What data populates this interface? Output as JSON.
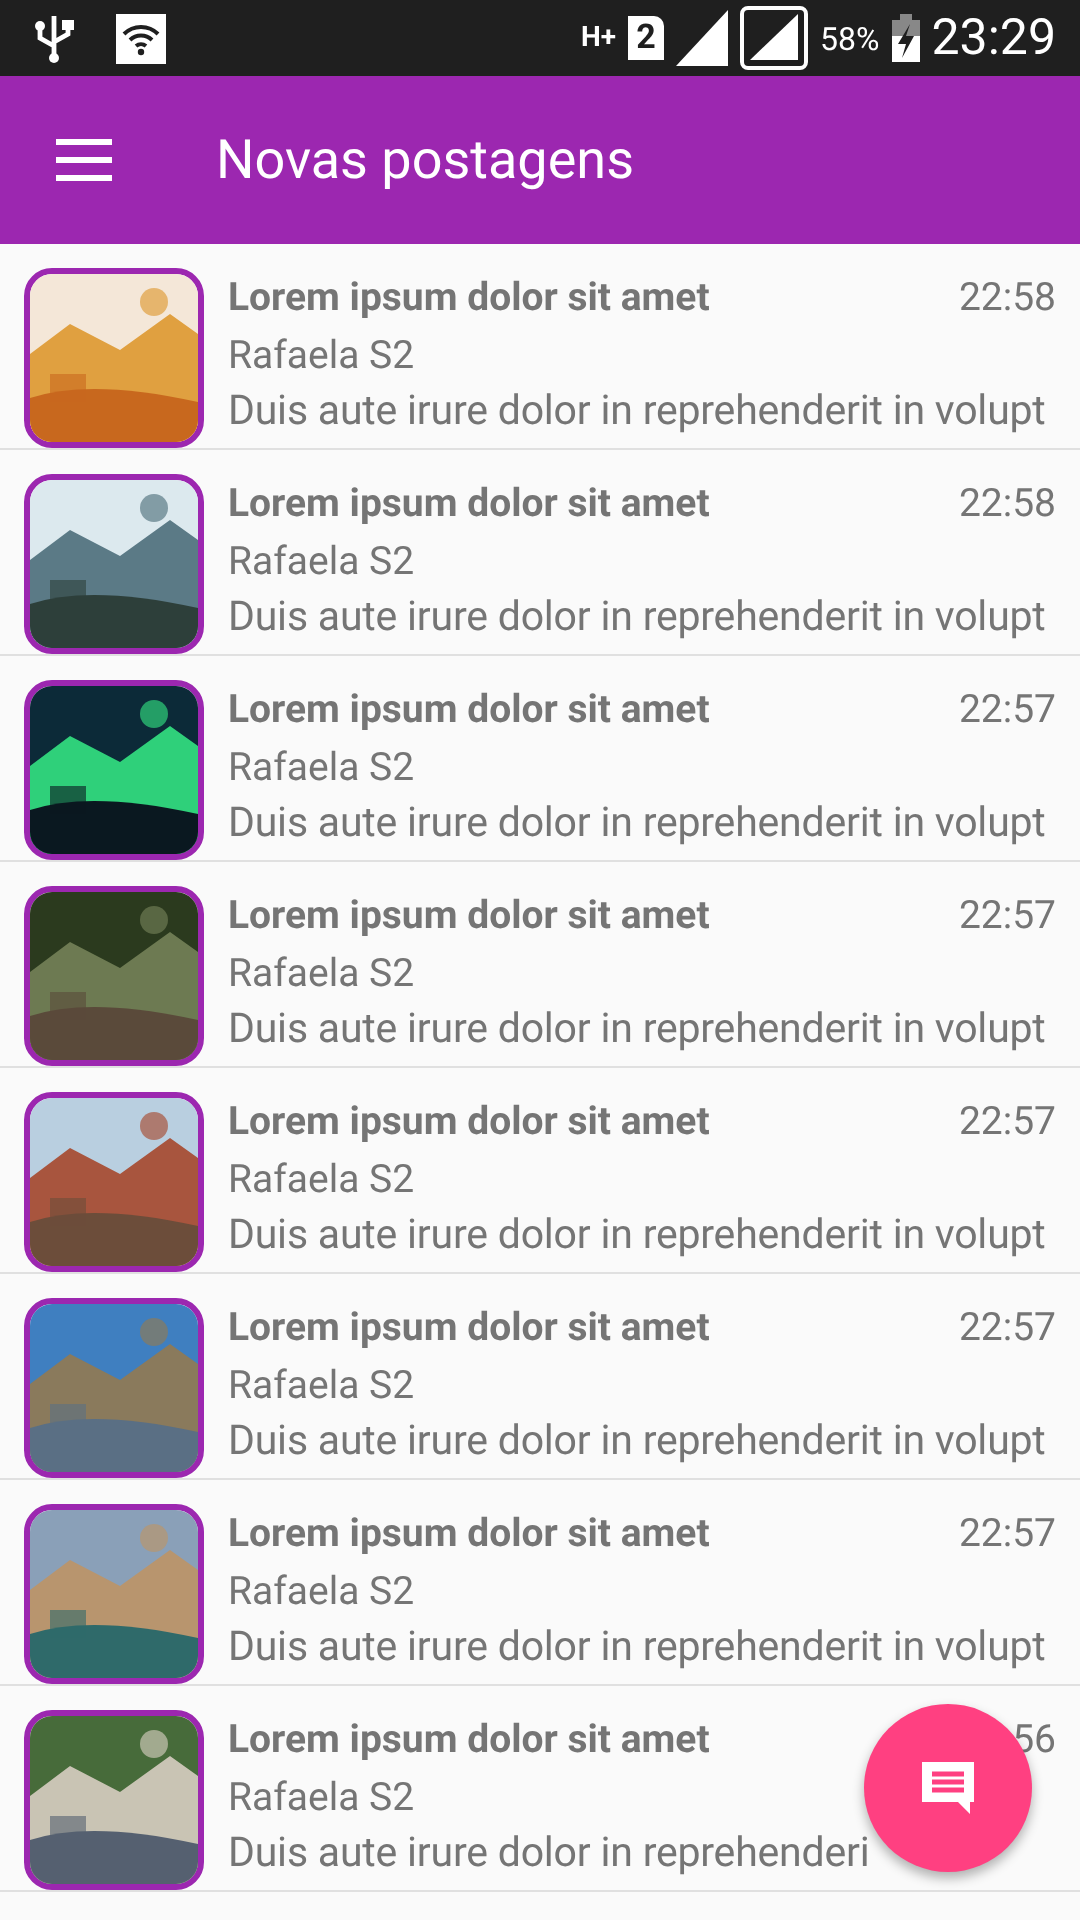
{
  "status_bar": {
    "network": "H+",
    "sim": "2",
    "battery": "58%",
    "time": "23:29"
  },
  "app_bar": {
    "title": "Novas postagens"
  },
  "posts": [
    {
      "kind": "picture",
      "title": "Lorem ipsum dolor sit amet",
      "time": "22:58",
      "author": "Rafaela S2",
      "excerpt": "Duis aute irure dolor in reprehenderit in volupt"
    },
    {
      "kind": "picture",
      "title": "Lorem ipsum dolor sit amet",
      "time": "22:58",
      "author": "Rafaela S2",
      "excerpt": "Duis aute irure dolor in reprehenderit in volupt"
    },
    {
      "kind": "picture",
      "title": "Lorem ipsum dolor sit amet",
      "time": "22:57",
      "author": "Rafaela S2",
      "excerpt": "Duis aute irure dolor in reprehenderit in volupt"
    },
    {
      "kind": "picture",
      "title": "Lorem ipsum dolor sit amet",
      "time": "22:57",
      "author": "Rafaela S2",
      "excerpt": "Duis aute irure dolor in reprehenderit in volupt"
    },
    {
      "kind": "picture",
      "title": "Lorem ipsum dolor sit amet",
      "time": "22:57",
      "author": "Rafaela S2",
      "excerpt": "Duis aute irure dolor in reprehenderit in volupt"
    },
    {
      "kind": "picture",
      "title": "Lorem ipsum dolor sit amet",
      "time": "22:57",
      "author": "Rafaela S2",
      "excerpt": "Duis aute irure dolor in reprehenderit in volupt"
    },
    {
      "kind": "picture",
      "title": "Lorem ipsum dolor sit amet",
      "time": "22:57",
      "author": "Rafaela S2",
      "excerpt": "Duis aute irure dolor in reprehenderit in volupt"
    },
    {
      "kind": "picture",
      "title": "Lorem ipsum dolor sit amet",
      "time": "56",
      "author": "Rafaela S2",
      "excerpt": "Duis aute irure dolor in reprehenderi"
    }
  ]
}
